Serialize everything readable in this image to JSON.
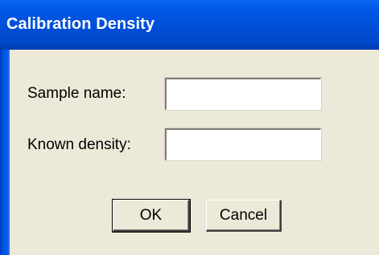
{
  "window": {
    "title": "Calibration Density"
  },
  "form": {
    "sample_name_label": "Sample name:",
    "sample_name_value": "",
    "known_density_label": "Known density:",
    "known_density_value": ""
  },
  "buttons": {
    "ok_label": "OK",
    "cancel_label": "Cancel"
  },
  "colors": {
    "titlebar": "#0050DA",
    "title_text": "#FFFFFF",
    "face": "#ECE9D8"
  }
}
